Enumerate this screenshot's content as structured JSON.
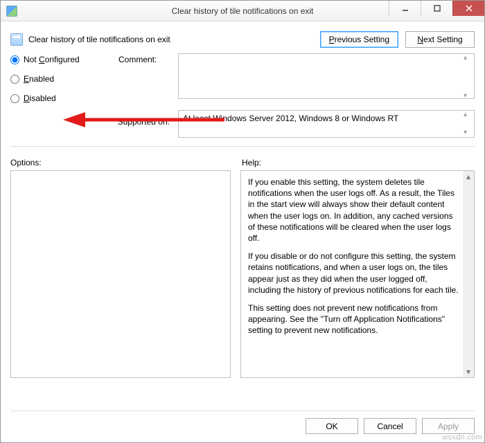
{
  "window": {
    "title": "Clear history of tile notifications on exit"
  },
  "header": {
    "setting_name": "Clear history of tile notifications on exit",
    "previous_html": "<span class='u'>P</span>revious Setting",
    "next_html": "<span class='u'>N</span>ext Setting"
  },
  "radios": {
    "not_configured_html": "Not <span class='u'>C</span>onfigured",
    "enabled_html": "<span class='u'>E</span>nabled",
    "disabled_html": "<span class='u'>D</span>isabled",
    "selected": "not_configured"
  },
  "labels": {
    "comment": "Comment:",
    "supported_on": "Supported on:",
    "options": "Options:",
    "help": "Help:"
  },
  "fields": {
    "comment_value": "",
    "supported_on_value": "At least Windows Server 2012, Windows 8 or Windows RT"
  },
  "help": {
    "p1": "If you enable this setting, the system deletes tile notifications when the user logs off. As a result, the Tiles in the start view will always show their default content when the user logs on. In addition, any cached versions of these notifications will be cleared when the user logs off.",
    "p2": "If you disable or do not configure this setting, the system retains notifications, and when a user logs on, the tiles appear just as they did when the user logged off, including the history of previous notifications for each tile.",
    "p3": "This setting does not prevent new notifications from appearing. See the \"Turn off Application Notifications\" setting to prevent new notifications."
  },
  "buttons": {
    "ok": "OK",
    "cancel": "Cancel",
    "apply_html": "<span class='u'>A</span>pply"
  },
  "watermark": "wsxdn.com"
}
